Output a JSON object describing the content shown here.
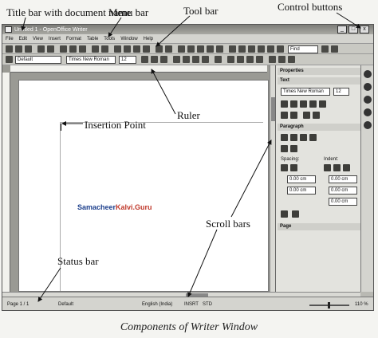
{
  "annotations": {
    "title_bar": "Title bar with document name",
    "menu_bar": "Menu bar",
    "tool_bar": "Tool bar",
    "control_buttons": "Control buttons",
    "ruler": "Ruler",
    "insertion_point": "Insertion Point",
    "scroll_bars": "Scroll bars",
    "status_bar": "Status bar"
  },
  "window": {
    "title": "Untitled 1 - OpenOffice Writer",
    "controls": {
      "minimize": "_",
      "maximize": "□",
      "close": "x"
    }
  },
  "menu": [
    "File",
    "Edit",
    "View",
    "Insert",
    "Format",
    "Table",
    "Tools",
    "Window",
    "Help"
  ],
  "toolbar": {
    "find_placeholder": "Find"
  },
  "format_bar": {
    "style": "Default",
    "font": "Times New Roman",
    "size": "12"
  },
  "sidebar": {
    "properties": "Properties",
    "text_section": "Text",
    "font": "Times New Roman",
    "size": "12",
    "paragraph_section": "Paragraph",
    "spacing_label": "Spacing:",
    "indent_label": "Indent:",
    "values": [
      "0.00 cm",
      "0.00 cm",
      "0.00 cm",
      "0.00 cm",
      "0.00 cm"
    ],
    "page_section": "Page"
  },
  "statusbar": {
    "page": "Page 1 / 1",
    "style": "Default",
    "language": "English (India)",
    "insert_mode": "INSRT",
    "selection_mode": "STD",
    "zoom": "110 %"
  },
  "watermark": {
    "part1": "Samacheer",
    "part2": "Kalvi.Guru"
  },
  "caption": "Components of Writer Window"
}
